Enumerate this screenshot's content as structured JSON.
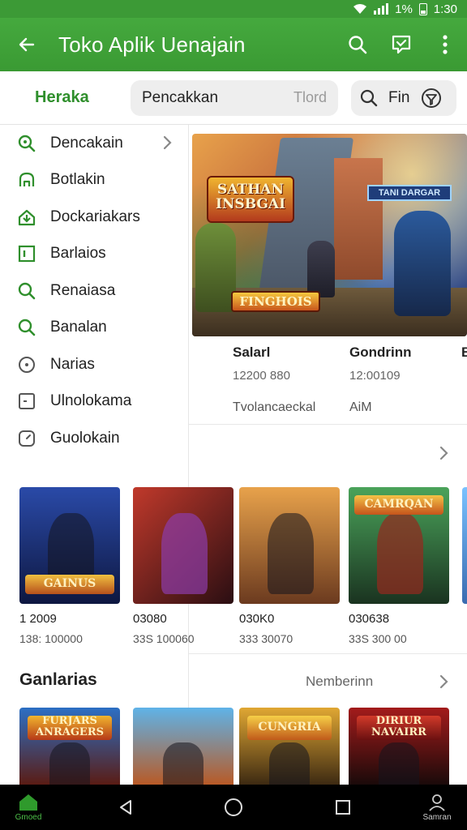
{
  "status": {
    "battery_percent": "1%",
    "time": "1:30"
  },
  "appbar": {
    "title": "Toko Aplik Uenajain"
  },
  "filterbar": {
    "brand": "Heraka",
    "search_value": "Pencakkan",
    "search_hint": "Tlord",
    "find_label": "Fin"
  },
  "sidebar": {
    "items": [
      {
        "label": "Dencakain",
        "icon": "search-icon",
        "has_chevron": true
      },
      {
        "label": "Botlakin",
        "icon": "controller-icon"
      },
      {
        "label": "Dockariakars",
        "icon": "download-icon"
      },
      {
        "label": "Barlaios",
        "icon": "frame-icon"
      },
      {
        "label": "Renaiasa",
        "icon": "search-icon"
      },
      {
        "label": "Banalan",
        "icon": "search-icon"
      },
      {
        "label": "Narias",
        "icon": "target-icon"
      },
      {
        "label": "Ulnolokama",
        "icon": "box-icon"
      },
      {
        "label": "Guolokain",
        "icon": "clock-icon"
      }
    ]
  },
  "hero": {
    "logo_main": "SATHAN INSBGAI",
    "logo_side": "TANI DARGAR",
    "logo_bottom": "FINGHOIS",
    "columns": [
      {
        "name": "Salarl",
        "value": "12200 880",
        "sub": "Tvolancaeckal"
      },
      {
        "name": "Gondrinn",
        "value": "12:00109",
        "sub": "AiM"
      },
      {
        "name": "B",
        "value": "",
        "sub": ""
      }
    ]
  },
  "games_row": [
    {
      "logo": "GAINUS",
      "p1": "1 2009",
      "p2": "138: 100000",
      "colors": [
        "#2a4aa8",
        "#0e1740"
      ]
    },
    {
      "logo": "",
      "p1": "03080",
      "p2": "33S 100060",
      "colors": [
        "#c0392b",
        "#2a0e12"
      ]
    },
    {
      "logo": "",
      "p1": "030K0",
      "p2": "333  30070",
      "colors": [
        "#e8a24b",
        "#6b3a1f"
      ]
    },
    {
      "logo": "CAMRQAN",
      "p1": "030638",
      "p2": "33S 300 00",
      "colors": [
        "#3c8a4a",
        "#1a3320"
      ]
    }
  ],
  "section2": {
    "title": "Ganlarias",
    "more": "Nemberinn"
  },
  "games_row2": [
    {
      "logo": "FURJARS ANRAGERS",
      "colors": [
        "#2c6fc4",
        "#5a1c14"
      ]
    },
    {
      "logo": "",
      "colors": [
        "#5fb3e8",
        "#b85a26"
      ]
    },
    {
      "logo": "CUNGRIA",
      "colors": [
        "#e0a733",
        "#3d2a12"
      ]
    },
    {
      "logo": "DIRIUR NAVAIRR",
      "colors": [
        "#a31b1b",
        "#1a0a0a"
      ]
    }
  ],
  "navbar": {
    "home_label": "Gmoed",
    "account_label": "Samran"
  },
  "colors": {
    "primary": "#3c9a36",
    "accent": "#2f8f2c"
  }
}
